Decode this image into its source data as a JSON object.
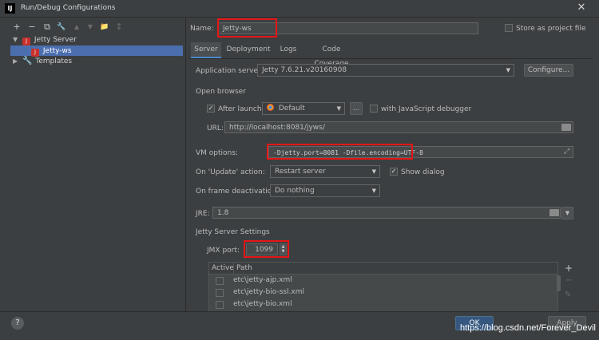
{
  "window": {
    "title": "Run/Debug Configurations",
    "app_icon_letter": "IJ",
    "close_glyph": "✕"
  },
  "toolbar": {
    "add": "+",
    "remove": "−",
    "copy": "⧉",
    "edit": "🔧",
    "up": "▲",
    "down": "▼",
    "folder": "📁",
    "sort": "↕"
  },
  "tree": {
    "jetty_server": "Jetty Server",
    "jetty_ws": "Jetty-ws",
    "templates": "Templates"
  },
  "form": {
    "name_label": "Name:",
    "name_value": "Jetty-ws",
    "store_label": "Store as project file",
    "tabs": [
      "Server",
      "Deployment",
      "Logs",
      "Code Coverage"
    ],
    "app_server_label": "Application server:",
    "app_server_value": "Jetty 7.6.21.v20160908",
    "configure_label": "Configure...",
    "open_browser_label": "Open browser",
    "after_launch_label": "After launch",
    "browser_value": "Default",
    "ellipsis": "...",
    "js_debugger_label": "with JavaScript debugger",
    "url_label": "URL:",
    "url_value": "http://localhost:8081/jyws/",
    "vm_label": "VM options:",
    "vm_value": "-Djetty.port=8081 -Dfile.encoding=UTF-8",
    "on_update_label": "On 'Update' action:",
    "on_update_value": "Restart server",
    "show_dialog_label": "Show dialog",
    "on_frame_label": "On frame deactivation:",
    "on_frame_value": "Do nothing",
    "jre_label": "JRE:",
    "jre_value": "1.8",
    "jetty_settings_label": "Jetty Server Settings",
    "jmx_label": "JMX port:",
    "jmx_value": "1099",
    "table_headers": [
      "Active",
      "Path"
    ],
    "table_rows": [
      "etc\\jetty-ajp.xml",
      "etc\\jetty-bio-ssl.xml",
      "etc\\jetty-bio.xml"
    ]
  },
  "footer": {
    "help": "?",
    "ok": "OK",
    "apply": "Apply"
  },
  "watermark": "https://blog.csdn.net/Forever_Devil"
}
